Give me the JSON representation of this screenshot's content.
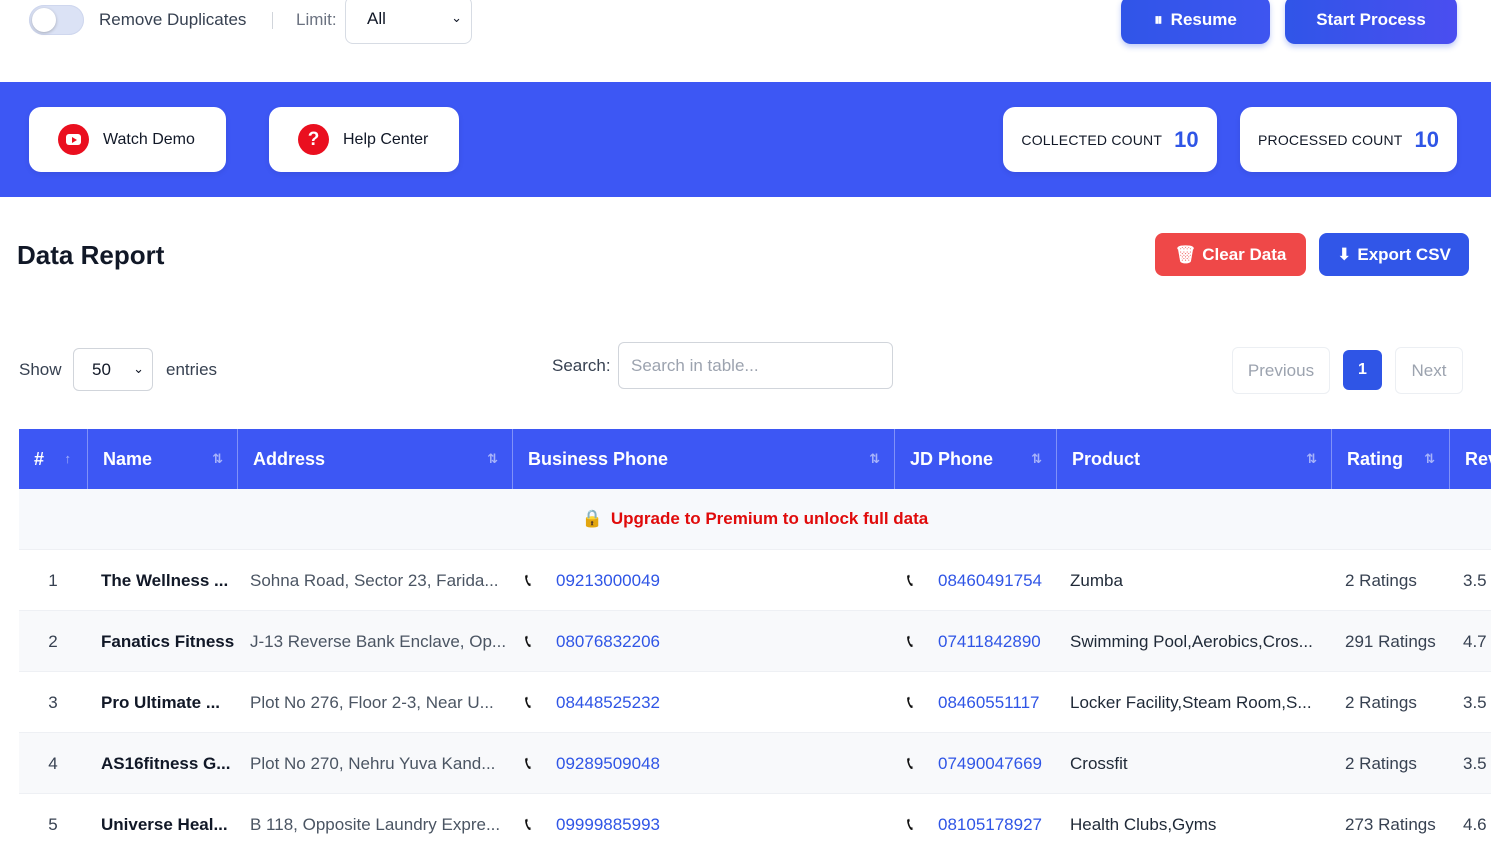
{
  "topbar": {
    "remove_duplicates_label": "Remove Duplicates",
    "limit_label": "Limit:",
    "limit_value": "All",
    "resume_label": "Resume",
    "start_label": "Start Process"
  },
  "band": {
    "watch_demo": "Watch Demo",
    "help_center": "Help Center",
    "collected_label": "COLLECTED COUNT",
    "collected_value": "10",
    "processed_label": "PROCESSED COUNT",
    "processed_value": "10"
  },
  "report": {
    "title": "Data Report",
    "clear_label": "Clear Data",
    "export_label": "Export CSV"
  },
  "controls": {
    "show_label": "Show",
    "entries_value": "50",
    "entries_label": "entries",
    "search_label": "Search:",
    "search_placeholder": "Search in table...",
    "prev_label": "Previous",
    "page_number": "1",
    "next_label": "Next"
  },
  "table": {
    "headers": [
      "#",
      "Name",
      "Address",
      "Business Phone",
      "JD Phone",
      "Product",
      "Rating",
      "Rev"
    ],
    "upgrade_text": "Upgrade to Premium to unlock full data",
    "rows": [
      {
        "idx": "1",
        "name": "The Wellness ...",
        "address": "Sohna Road, Sector 23, Farida...",
        "business_phone": "09213000049",
        "jd_phone": "08460491754",
        "product": "Zumba",
        "rating": "2 Ratings",
        "rev": "3.5"
      },
      {
        "idx": "2",
        "name": "Fanatics Fitness",
        "address": "J-13 Reverse Bank Enclave, Op...",
        "business_phone": "08076832206",
        "jd_phone": "07411842890",
        "product": "Swimming Pool,Aerobics,Cros...",
        "rating": "291 Ratings",
        "rev": "4.7"
      },
      {
        "idx": "3",
        "name": "Pro Ultimate ...",
        "address": "Plot No 276, Floor 2-3, Near U...",
        "business_phone": "08448525232",
        "jd_phone": "08460551117",
        "product": "Locker Facility,Steam Room,S...",
        "rating": "2 Ratings",
        "rev": "3.5"
      },
      {
        "idx": "4",
        "name": "AS16fitness G...",
        "address": "Plot No 270, Nehru Yuva Kand...",
        "business_phone": "09289509048",
        "jd_phone": "07490047669",
        "product": "Crossfit",
        "rating": "2 Ratings",
        "rev": "3.5"
      },
      {
        "idx": "5",
        "name": "Universe Heal...",
        "address": "B 118, Opposite Laundry Expre...",
        "business_phone": "09999885993",
        "jd_phone": "08105178927",
        "product": "Health Clubs,Gyms",
        "rating": "273 Ratings",
        "rev": "4.6"
      }
    ]
  },
  "colors": {
    "accent": "#3d57f4",
    "danger": "#ef4848",
    "link": "#2f55e6",
    "upgrade": "#e00b0b"
  }
}
